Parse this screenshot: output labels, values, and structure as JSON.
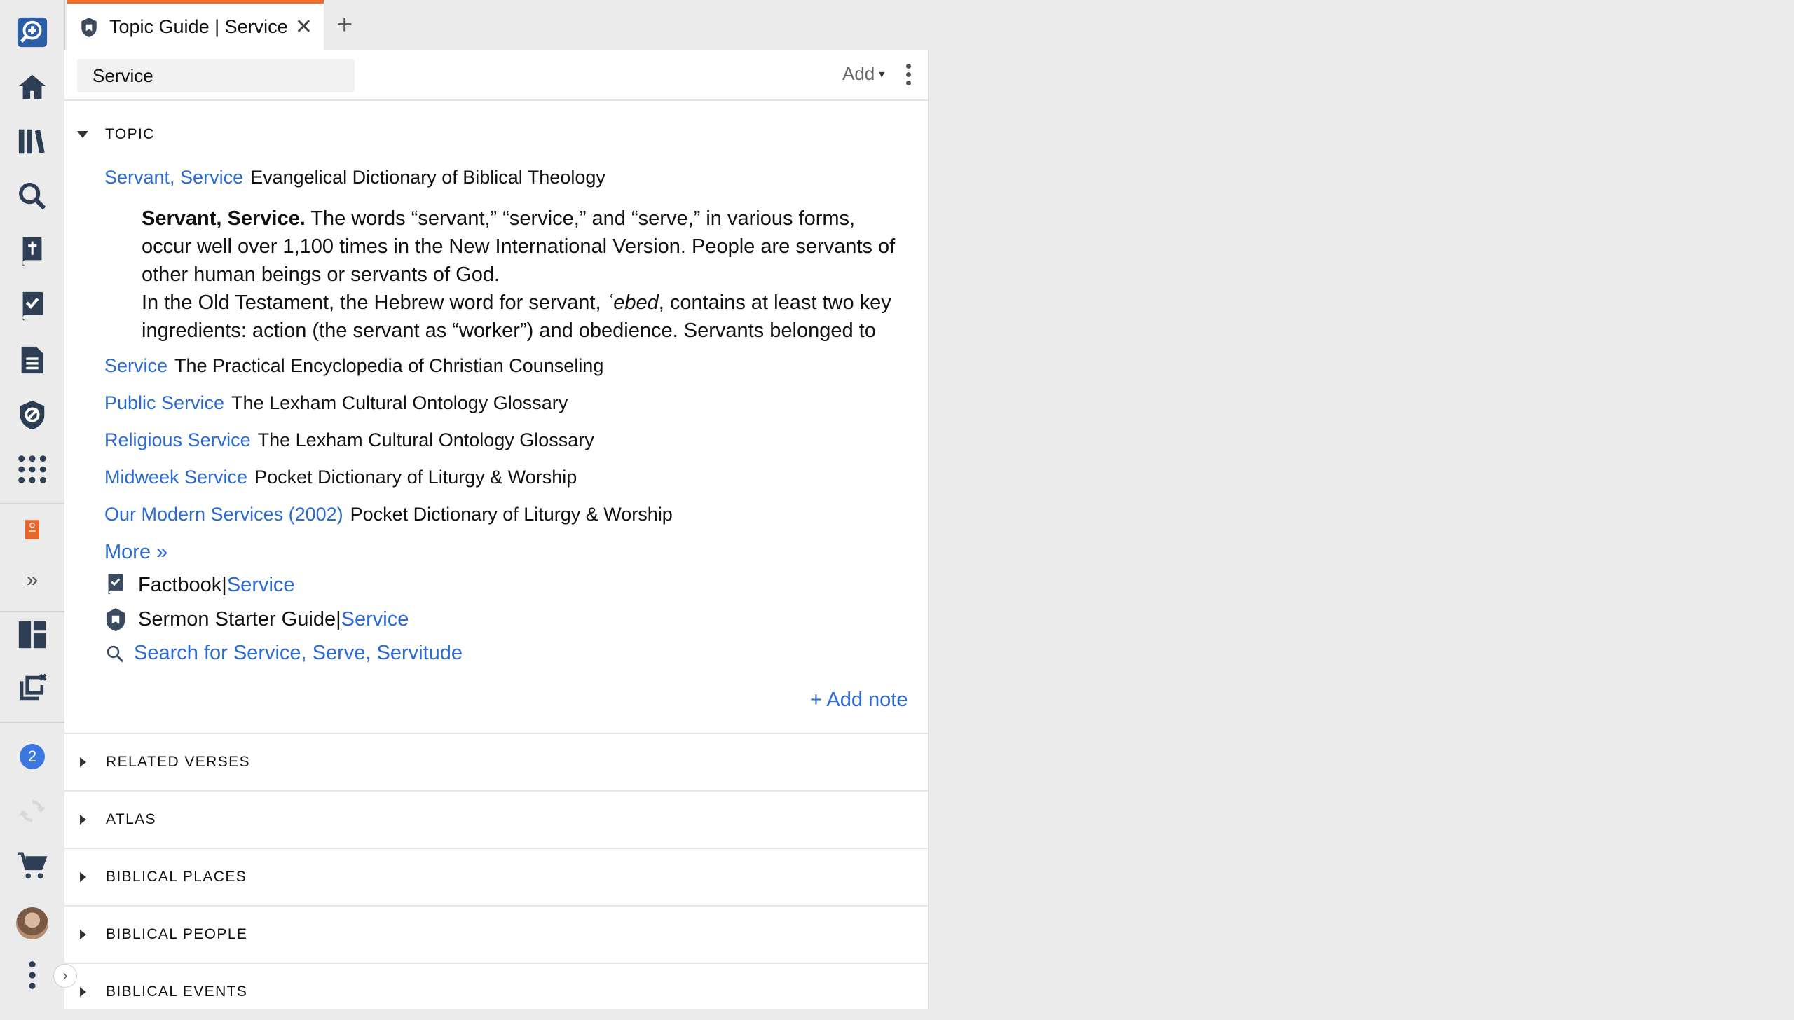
{
  "tab": {
    "title": "Topic Guide | Service",
    "close_glyph": "✕",
    "new_tab_glyph": "+",
    "accent": "#ef6c2b"
  },
  "toolbar": {
    "search_value": "Service",
    "add_label": "Add",
    "add_caret": "▾"
  },
  "rail": {
    "notification_count": "2",
    "expand_glyph": "»",
    "collapse_glyph": "›",
    "icons": [
      "search-add-icon",
      "home-icon",
      "library-icon",
      "search-icon",
      "bible-icon",
      "factbook-icon",
      "document-icon",
      "sermon-guide-icon",
      "apps-grid-icon",
      "book-cover-icon",
      "expand-icon",
      "layouts-icon",
      "close-windows-icon",
      "notifications-icon",
      "sync-icon",
      "cart-icon",
      "avatar",
      "more-icon"
    ]
  },
  "topic": {
    "header": "TOPIC",
    "entries": [
      {
        "link": "Servant, Service",
        "source": "Evangelical Dictionary of Biblical Theology"
      },
      {
        "link": "Service",
        "source": "The Practical Encyclopedia of Christian Counseling"
      },
      {
        "link": "Public Service",
        "source": "The Lexham Cultural Ontology Glossary"
      },
      {
        "link": "Religious Service",
        "source": "The Lexham Cultural Ontology Glossary"
      },
      {
        "link": "Midweek Service",
        "source": "Pocket Dictionary of Liturgy & Worship"
      },
      {
        "link": "Our Modern Services (2002)",
        "source": "Pocket Dictionary of Liturgy & Worship"
      }
    ],
    "excerpt": {
      "bold": "Servant, Service.",
      "p1": " The words “servant,” “service,” and “serve,” in various forms, occur well over 1,100 times in the New International Version. People are servants of other human beings or servants of God.",
      "p2_before": "In the Old Testament, the Hebrew word for servant, ",
      "p2_italic": "ʿebed",
      "p2_after": ", contains at least two key ingredients: action (the servant as “worker”) and obedience. Servants belonged to"
    },
    "more": "More »",
    "factbook": {
      "label": "Factbook",
      "sep": " | ",
      "link": "Service"
    },
    "sermon_guide": {
      "label": "Sermon Starter Guide",
      "sep": " | ",
      "link": "Service"
    },
    "search_link": "Search for Service, Serve, Servitude",
    "add_note": "+ Add note"
  },
  "sections": [
    {
      "label": "RELATED VERSES"
    },
    {
      "label": "ATLAS"
    },
    {
      "label": "BIBLICAL PLACES"
    },
    {
      "label": "BIBLICAL PEOPLE"
    },
    {
      "label": "BIBLICAL EVENTS"
    }
  ],
  "colors": {
    "link": "#2a6ad2",
    "icon": "#2d3e55",
    "badge": "#3a78e0"
  }
}
